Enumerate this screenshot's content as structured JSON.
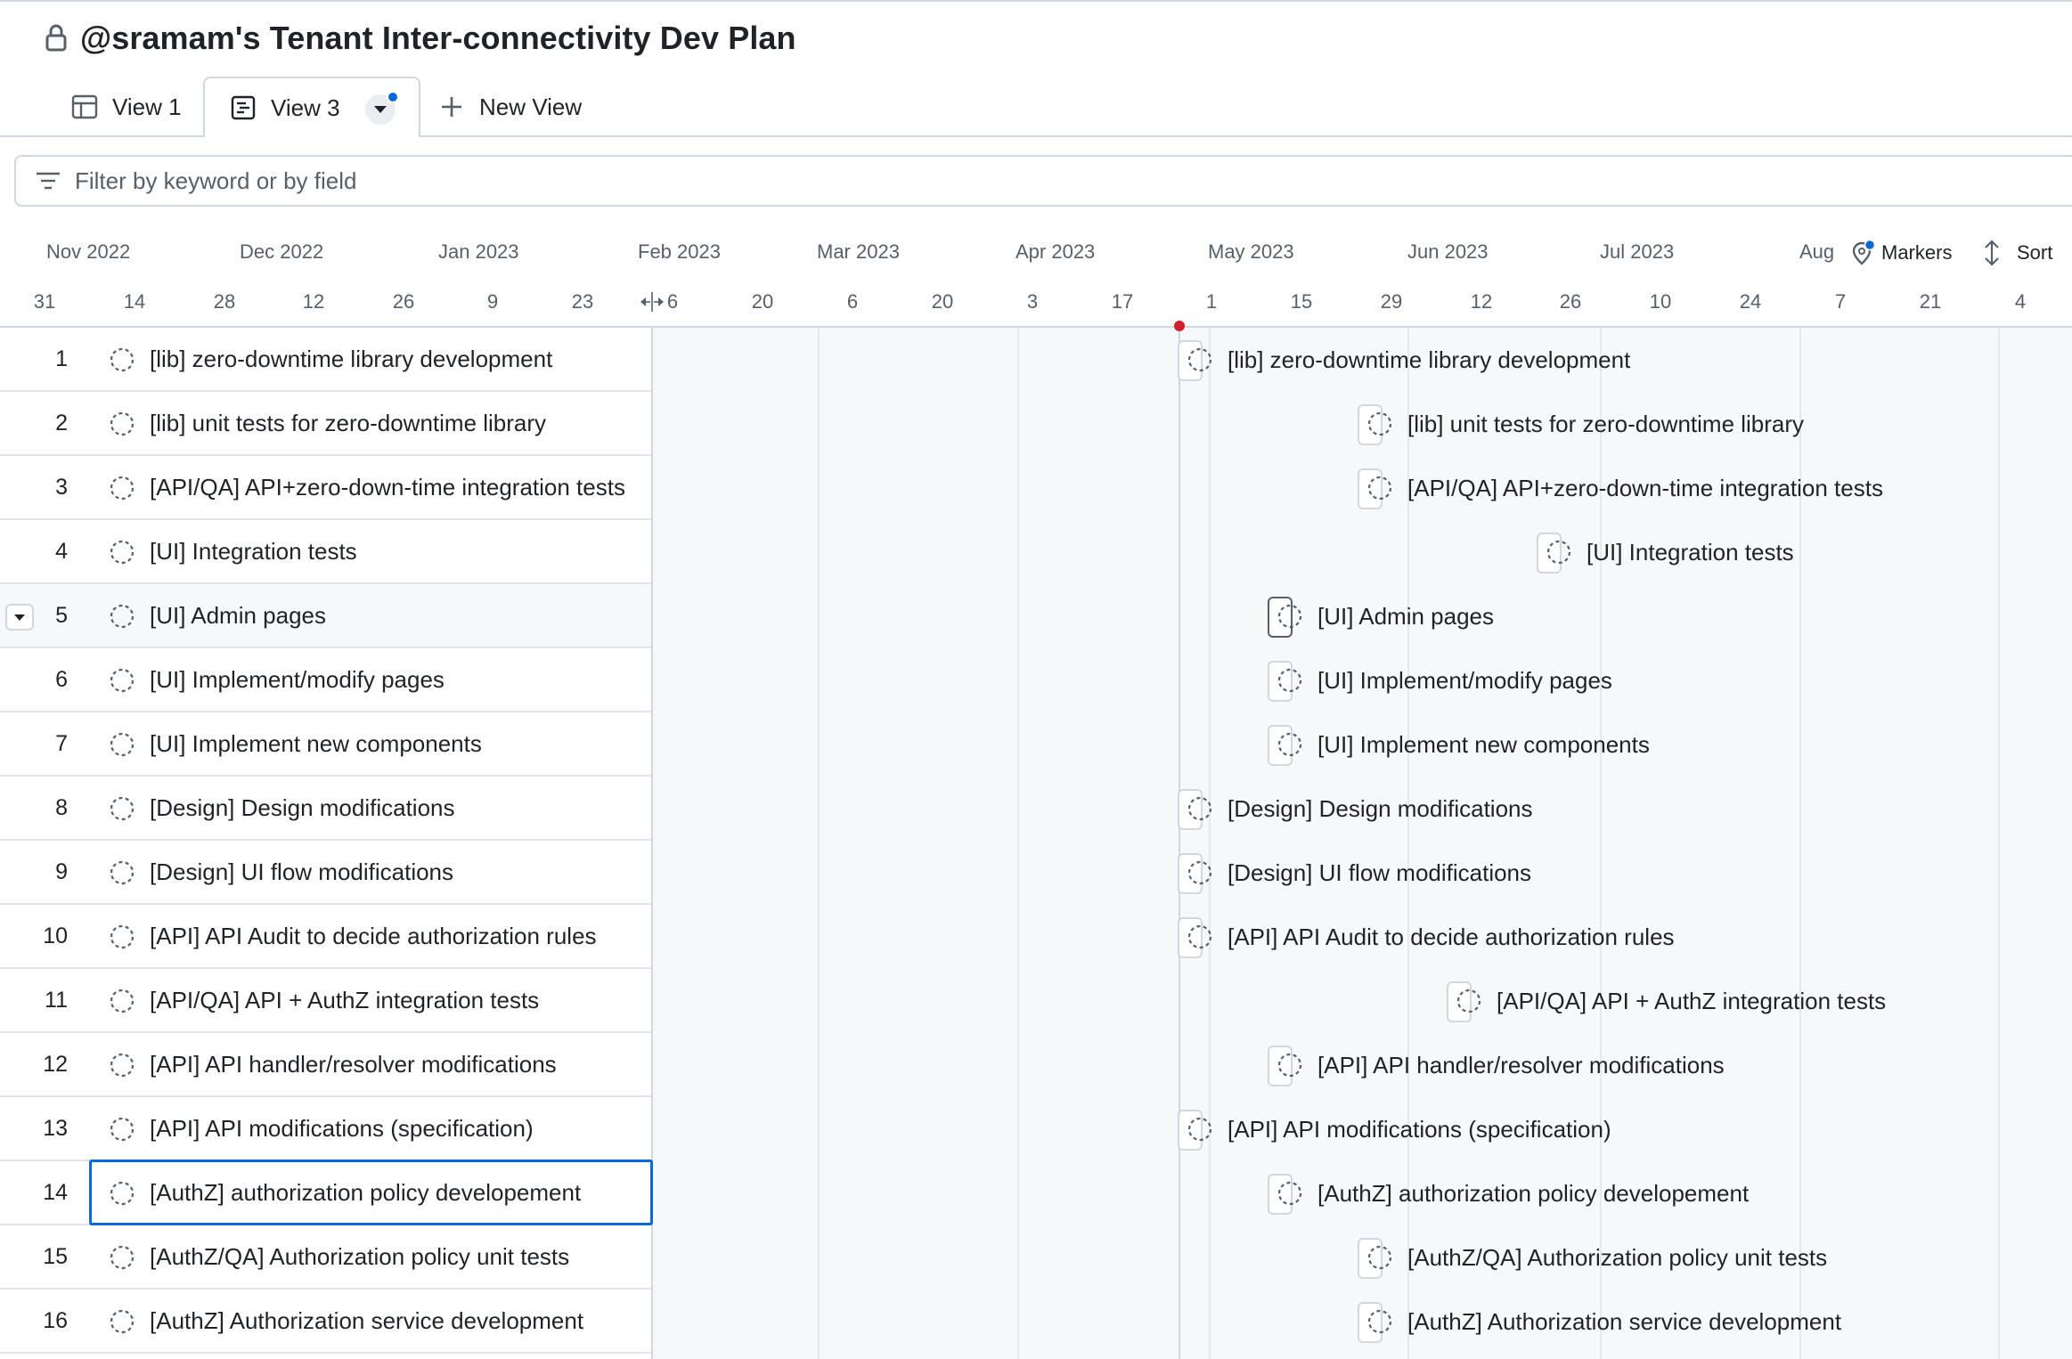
{
  "project": {
    "title": "@sramam's Tenant Inter-connectivity Dev Plan",
    "icon": "lock-icon"
  },
  "views": {
    "tabs": [
      {
        "label": "View 1",
        "icon": "table-icon"
      },
      {
        "label": "View 3",
        "icon": "roadmap-icon",
        "active": true
      }
    ],
    "new_view_label": "New View"
  },
  "filter": {
    "placeholder": "Filter by keyword or by field",
    "value": ""
  },
  "timeline": {
    "months": [
      "Nov 2022",
      "Dec 2022",
      "Jan 2023",
      "Feb 2023",
      "Mar 2023",
      "Apr 2023",
      "May 2023",
      "Jun 2023",
      "Jul 2023",
      "Aug"
    ],
    "days": [
      "31",
      "14",
      "28",
      "12",
      "26",
      "9",
      "23",
      "6",
      "20",
      "6",
      "20",
      "3",
      "17",
      "1",
      "15",
      "29",
      "12",
      "26",
      "10",
      "24",
      "7",
      "21",
      "4"
    ],
    "markers_label": "Markers",
    "sort_label": "Sort",
    "accent_color": "#0969da",
    "today_color": "#cf222e"
  },
  "rows": [
    {
      "num": "1",
      "title": "[lib] zero-downtime library development"
    },
    {
      "num": "2",
      "title": "[lib] unit tests for zero-downtime library"
    },
    {
      "num": "3",
      "title": "[API/QA] API+zero-down-time integration tests"
    },
    {
      "num": "4",
      "title": "[UI] Integration tests"
    },
    {
      "num": "5",
      "title": "[UI] Admin pages"
    },
    {
      "num": "6",
      "title": "[UI] Implement/modify pages"
    },
    {
      "num": "7",
      "title": "[UI] Implement new components"
    },
    {
      "num": "8",
      "title": "[Design] Design modifications"
    },
    {
      "num": "9",
      "title": "[Design] UI flow modifications"
    },
    {
      "num": "10",
      "title": "[API] API Audit to decide authorization rules"
    },
    {
      "num": "11",
      "title": "[API/QA] API + AuthZ integration tests"
    },
    {
      "num": "12",
      "title": "[API] API handler/resolver modifications"
    },
    {
      "num": "13",
      "title": "[API] API modifications (specification)"
    },
    {
      "num": "14",
      "title": "[AuthZ] authorization policy developement"
    },
    {
      "num": "15",
      "title": "[AuthZ/QA] Authorization policy unit tests"
    },
    {
      "num": "16",
      "title": "[AuthZ] Authorization service development"
    }
  ],
  "timeline_items": [
    {
      "label": "[lib] zero-downtime library development"
    },
    {
      "label": "[lib] unit tests for zero-downtime library"
    },
    {
      "label": "[API/QA] API+zero-down-time integration tests"
    },
    {
      "label": "[UI] Integration tests"
    },
    {
      "label": "[UI] Admin pages"
    },
    {
      "label": "[UI] Implement/modify pages"
    },
    {
      "label": "[UI] Implement new components"
    },
    {
      "label": "[Design] Design modifications"
    },
    {
      "label": "[Design] UI flow modifications"
    },
    {
      "label": "[API] API Audit to decide authorization rules"
    },
    {
      "label": "[API/QA] API + AuthZ integration tests"
    },
    {
      "label": "[API] API handler/resolver modifications"
    },
    {
      "label": "[API] API modifications (specification)"
    },
    {
      "label": "[AuthZ] authorization policy developement"
    },
    {
      "label": "[AuthZ/QA] Authorization policy unit tests"
    },
    {
      "label": "[AuthZ] Authorization service development"
    }
  ]
}
